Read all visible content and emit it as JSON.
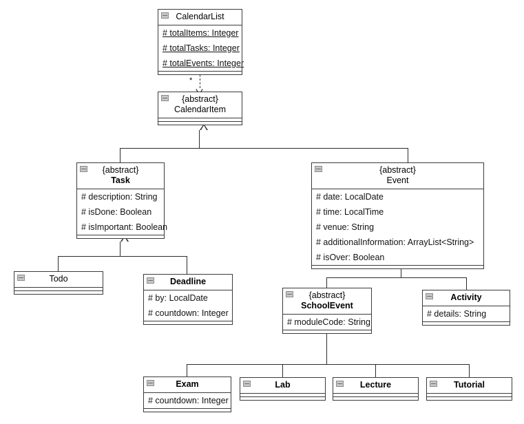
{
  "diagram": {
    "kind": "uml-class-diagram",
    "classes": [
      {
        "id": "calendarlist",
        "name": "CalendarList",
        "stereotype": "",
        "abstract": false,
        "attributes": [
          {
            "text": "# totalItems: Integer",
            "static": true
          },
          {
            "text": "# totalTasks: Integer",
            "static": true
          },
          {
            "text": "# totalEvents: Integer",
            "static": true
          }
        ]
      },
      {
        "id": "calendaritem",
        "name": "CalendarItem",
        "stereotype": "{abstract}",
        "abstract": true,
        "attributes": []
      },
      {
        "id": "task",
        "name": "Task",
        "stereotype": "{abstract}",
        "abstract": true,
        "attributes": [
          {
            "text": "# description: String",
            "static": false
          },
          {
            "text": "# isDone: Boolean",
            "static": false
          },
          {
            "text": "# isImportant: Boolean",
            "static": false
          }
        ]
      },
      {
        "id": "event",
        "name": "Event",
        "stereotype": "{abstract}",
        "abstract": true,
        "attributes": [
          {
            "text": "# date: LocalDate",
            "static": false
          },
          {
            "text": "# time: LocalTime",
            "static": false
          },
          {
            "text": "# venue: String",
            "static": false
          },
          {
            "text": "# additionalInformation: ArrayList<String>",
            "static": false
          },
          {
            "text": "# isOver: Boolean",
            "static": false
          }
        ]
      },
      {
        "id": "todo",
        "name": "Todo",
        "stereotype": "",
        "abstract": false,
        "attributes": []
      },
      {
        "id": "deadline",
        "name": "Deadline",
        "stereotype": "",
        "abstract": false,
        "attributes": [
          {
            "text": "# by: LocalDate",
            "static": false
          },
          {
            "text": "# countdown: Integer",
            "static": false
          }
        ]
      },
      {
        "id": "schoolevent",
        "name": "SchoolEvent",
        "stereotype": "{abstract}",
        "abstract": true,
        "attributes": [
          {
            "text": "# moduleCode: String",
            "static": false
          }
        ]
      },
      {
        "id": "activity",
        "name": "Activity",
        "stereotype": "",
        "abstract": false,
        "attributes": [
          {
            "text": "# details: String",
            "static": false
          }
        ]
      },
      {
        "id": "exam",
        "name": "Exam",
        "stereotype": "",
        "abstract": false,
        "attributes": [
          {
            "text": "# countdown: Integer",
            "static": false
          }
        ]
      },
      {
        "id": "lab",
        "name": "Lab",
        "stereotype": "",
        "abstract": false,
        "attributes": []
      },
      {
        "id": "lecture",
        "name": "Lecture",
        "stereotype": "",
        "abstract": false,
        "attributes": []
      },
      {
        "id": "tutorial",
        "name": "Tutorial",
        "stereotype": "",
        "abstract": false,
        "attributes": []
      }
    ],
    "relationships": [
      {
        "id": "rel-calendarlist-calendaritem",
        "type": "aggregation-dependency",
        "from": "CalendarList",
        "to": "CalendarItem",
        "multiplicity": "*",
        "line": "dashed",
        "source_decoration": "hollow-diamond",
        "target_decoration": "open-arrow"
      },
      {
        "id": "rel-task-calendaritem",
        "type": "generalization",
        "from": "Task",
        "to": "CalendarItem",
        "multiplicity": "",
        "line": "solid",
        "source_decoration": "",
        "target_decoration": "hollow-triangle"
      },
      {
        "id": "rel-event-calendaritem",
        "type": "generalization",
        "from": "Event",
        "to": "CalendarItem",
        "multiplicity": "",
        "line": "solid",
        "source_decoration": "",
        "target_decoration": "hollow-triangle"
      },
      {
        "id": "rel-todo-task",
        "type": "generalization",
        "from": "Todo",
        "to": "Task",
        "multiplicity": "",
        "line": "solid",
        "source_decoration": "",
        "target_decoration": "hollow-triangle"
      },
      {
        "id": "rel-deadline-task",
        "type": "generalization",
        "from": "Deadline",
        "to": "Task",
        "multiplicity": "",
        "line": "solid",
        "source_decoration": "",
        "target_decoration": "hollow-triangle"
      },
      {
        "id": "rel-schoolevent-event",
        "type": "generalization",
        "from": "SchoolEvent",
        "to": "Event",
        "multiplicity": "",
        "line": "solid",
        "source_decoration": "",
        "target_decoration": "hollow-triangle"
      },
      {
        "id": "rel-activity-event",
        "type": "generalization",
        "from": "Activity",
        "to": "Event",
        "multiplicity": "",
        "line": "solid",
        "source_decoration": "",
        "target_decoration": "hollow-triangle"
      },
      {
        "id": "rel-exam-schoolevent",
        "type": "generalization",
        "from": "Exam",
        "to": "SchoolEvent",
        "multiplicity": "",
        "line": "solid",
        "source_decoration": "",
        "target_decoration": "hollow-triangle"
      },
      {
        "id": "rel-lab-schoolevent",
        "type": "generalization",
        "from": "Lab",
        "to": "SchoolEvent",
        "multiplicity": "",
        "line": "solid",
        "source_decoration": "",
        "target_decoration": "hollow-triangle"
      },
      {
        "id": "rel-lecture-schoolevent",
        "type": "generalization",
        "from": "Lecture",
        "to": "SchoolEvent",
        "multiplicity": "",
        "line": "solid",
        "source_decoration": "",
        "target_decoration": "hollow-triangle"
      },
      {
        "id": "rel-tutorial-schoolevent",
        "type": "generalization",
        "from": "Tutorial",
        "to": "SchoolEvent",
        "multiplicity": "",
        "line": "solid",
        "source_decoration": "",
        "target_decoration": "hollow-triangle"
      }
    ],
    "colors": {
      "background": "#ffffff",
      "border": "#3a3a3a",
      "line": "#2b2b2b",
      "text": "#000000",
      "icon_fill": "#c8c8c8",
      "icon_border": "#8a8a8a"
    }
  }
}
